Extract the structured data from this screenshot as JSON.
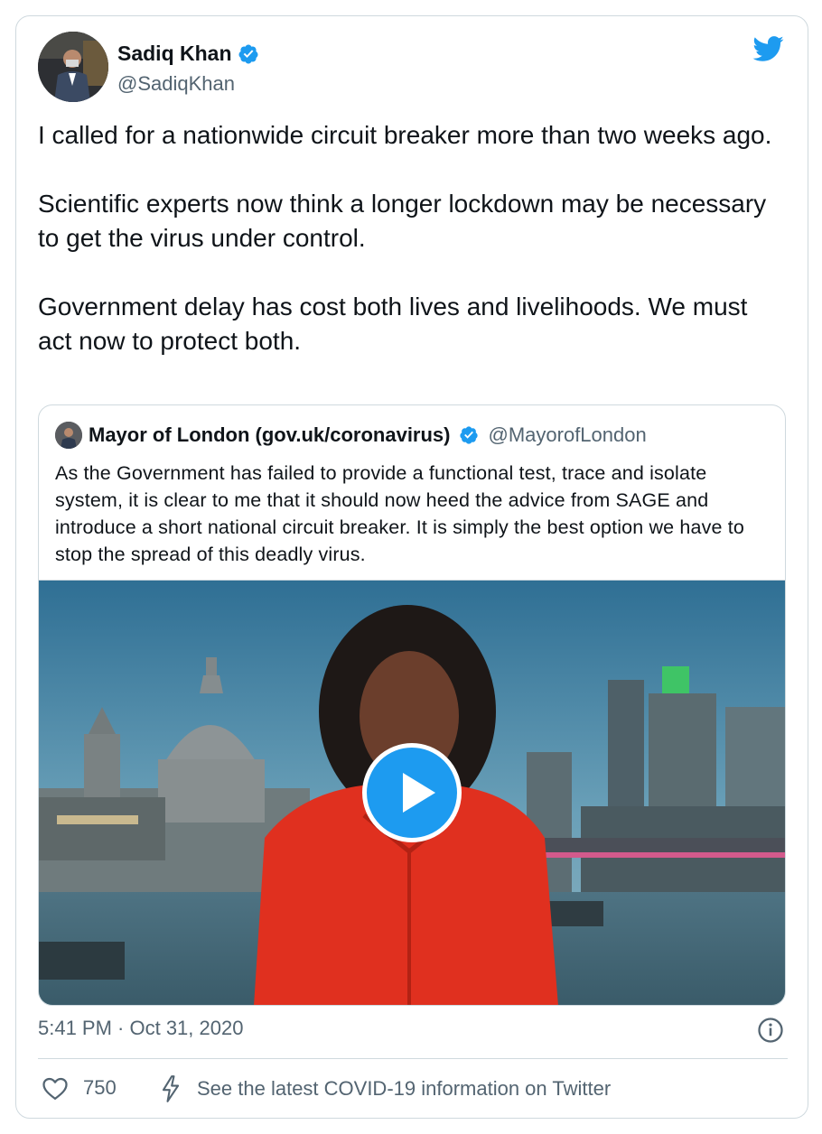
{
  "author": {
    "display_name": "Sadiq Khan",
    "handle": "@SadiqKhan",
    "verified_icon": "verified-badge-icon"
  },
  "tweet": {
    "paragraphs": [
      "I called for a nationwide circuit breaker more than two weeks ago.",
      "Scientific experts now think a longer lockdown may be necessary to get the virus under control.",
      "Government delay has cost both lives and livelihoods. We must act now to protect both."
    ],
    "timestamp": "5:41 PM · Oct 31, 2020"
  },
  "quoted_tweet": {
    "display_name": "Mayor of London (gov.uk/coronavirus)",
    "handle": "@MayorofLondon",
    "text": "As the Government has failed to provide a functional test, trace and isolate system, it is clear to me that it should now heed the advice from SAGE and introduce a short national circuit breaker. It is simply the best option we have to stop the spread of this deadly virus.",
    "media": "video",
    "play_icon": "play-icon"
  },
  "actions": {
    "like_count": "750",
    "covid_info": "See the latest COVID-19 information on Twitter"
  },
  "colors": {
    "twitter_blue": "#1d9bf0",
    "text_primary": "#0f1419",
    "text_secondary": "#536471",
    "border": "#cfd9de"
  }
}
